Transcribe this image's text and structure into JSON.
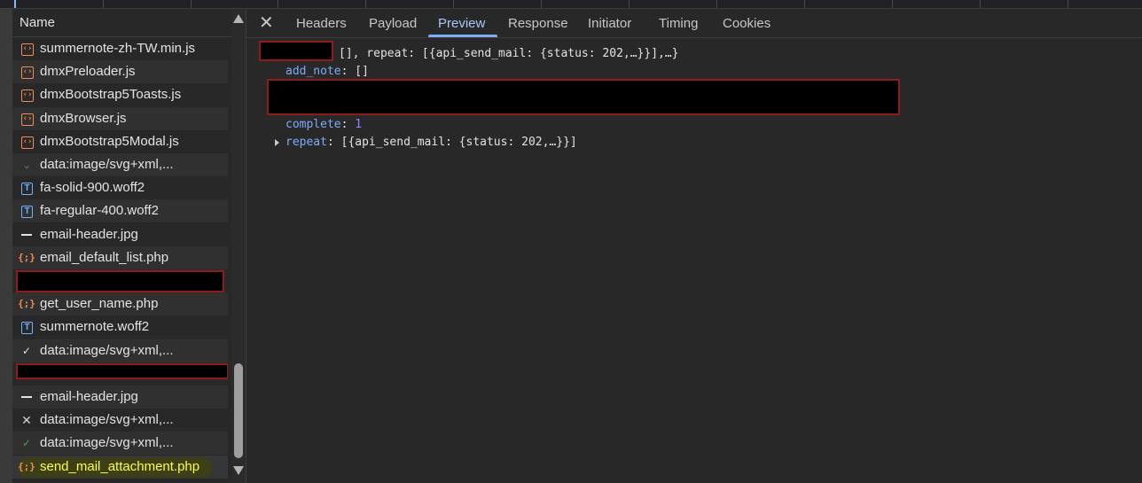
{
  "list_header": "Name",
  "files": [
    {
      "icon": "script",
      "name": "summernote-zh-TW.min.js"
    },
    {
      "icon": "script",
      "name": "dmxPreloader.js"
    },
    {
      "icon": "script",
      "name": "dmxBootstrap5Toasts.js"
    },
    {
      "icon": "script",
      "name": "dmxBrowser.js"
    },
    {
      "icon": "script",
      "name": "dmxBootstrap5Modal.js"
    },
    {
      "icon": "svg-chevron",
      "name": "data:image/svg+xml,..."
    },
    {
      "icon": "font",
      "name": "fa-solid-900.woff2"
    },
    {
      "icon": "font",
      "name": "fa-regular-400.woff2"
    },
    {
      "icon": "image",
      "name": "email-header.jpg"
    },
    {
      "icon": "json",
      "name": "email_default_list.php"
    },
    {
      "icon": "redacted",
      "name": ""
    },
    {
      "icon": "json",
      "name": "get_user_name.php"
    },
    {
      "icon": "font",
      "name": "summernote.woff2"
    },
    {
      "icon": "svg-check",
      "name": "data:image/svg+xml,..."
    },
    {
      "icon": "redacted",
      "name": ""
    },
    {
      "icon": "image",
      "name": "email-header.jpg"
    },
    {
      "icon": "svg-x",
      "name": "data:image/svg+xml,..."
    },
    {
      "icon": "svg-check-green",
      "name": "data:image/svg+xml,..."
    },
    {
      "icon": "json",
      "name": "send_mail_attachment.php"
    }
  ],
  "tabs": [
    "Headers",
    "Payload",
    "Preview",
    "Response",
    "Initiator",
    "Timing",
    "Cookies"
  ],
  "active_tab": "Preview",
  "preview": {
    "summary_rest": "[], repeat: [{api_send_mail: {status: 202,…}}],…}",
    "add_note_key": "add_note",
    "add_note_val": "[]",
    "complete_key": "complete",
    "complete_val": "1",
    "repeat_key": "repeat",
    "repeat_val": "[{api_send_mail: {status: 202,…}}]"
  },
  "colors": {
    "accent": "#7cacf8",
    "highlight": "#ffff33",
    "redact_border": "#8e1c1c"
  }
}
